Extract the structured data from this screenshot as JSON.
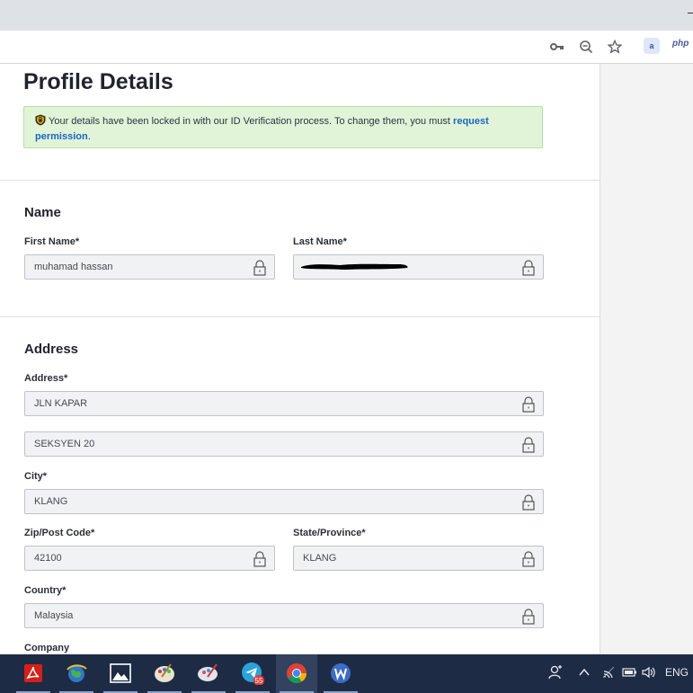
{
  "page": {
    "title": "Profile Details",
    "notice_text": "Your details have been locked in with our ID Verification process. To change them, you must",
    "notice_link": "request permission",
    "notice_end": "."
  },
  "name_section": {
    "title": "Name",
    "first_name": {
      "label": "First Name*",
      "value": "muhamad hassan"
    },
    "last_name": {
      "label": "Last Name*",
      "value": ""
    }
  },
  "address_section": {
    "title": "Address",
    "address": {
      "label": "Address*",
      "line1": "JLN KAPAR",
      "line2": "SEKSYEN 20"
    },
    "city": {
      "label": "City*",
      "value": "KLANG"
    },
    "zip": {
      "label": "Zip/Post Code*",
      "value": "42100"
    },
    "state": {
      "label": "State/Province*",
      "value": "KLANG"
    },
    "country": {
      "label": "Country*",
      "value": "Malaysia"
    },
    "company": {
      "label": "Company"
    }
  },
  "browser": {
    "extension_php": "php",
    "extension_badge": "a"
  },
  "taskbar": {
    "telegram_badge": "55",
    "language": "ENG",
    "icons": [
      "acrobat-icon",
      "earth-icon",
      "photos-icon",
      "paint-icon",
      "paint3d-icon",
      "telegram-icon",
      "chrome-icon",
      "word-icon"
    ]
  },
  "colors": {
    "notice_bg": "#e1f4d8",
    "link": "#1a66c4",
    "taskbar": "#1e2b44"
  }
}
